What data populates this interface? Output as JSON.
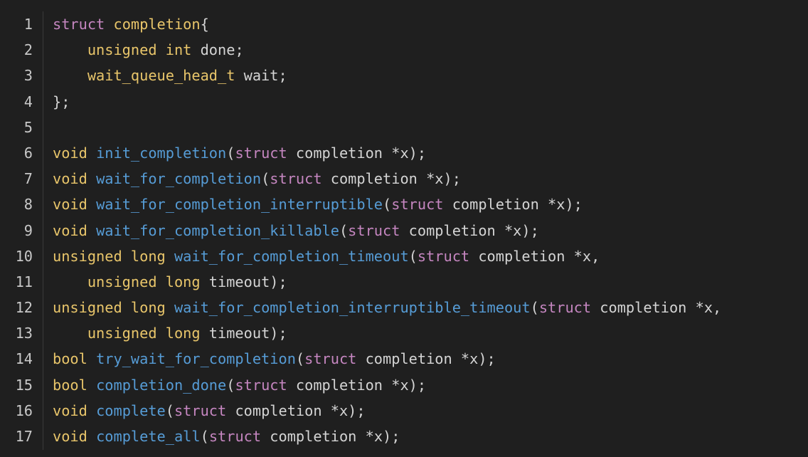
{
  "colors": {
    "background": "#1f1f1f",
    "keyword": "#e8c56a",
    "struct_keyword": "#c586c0",
    "function": "#569cd6",
    "plain": "#d4d4d4",
    "line_number": "#c8c8c8"
  },
  "lines": [
    {
      "num": "1",
      "tokens": [
        {
          "t": "struct",
          "k": "struct"
        },
        {
          "t": " ",
          "k": "space"
        },
        {
          "t": "completion",
          "k": "type"
        },
        {
          "t": "{",
          "k": "plain"
        }
      ]
    },
    {
      "num": "2",
      "tokens": [
        {
          "t": "    ",
          "k": "space"
        },
        {
          "t": "unsigned",
          "k": "keyword"
        },
        {
          "t": " ",
          "k": "space"
        },
        {
          "t": "int",
          "k": "keyword"
        },
        {
          "t": " done;",
          "k": "plain"
        }
      ]
    },
    {
      "num": "3",
      "tokens": [
        {
          "t": "    ",
          "k": "space"
        },
        {
          "t": "wait_queue_head_t",
          "k": "type"
        },
        {
          "t": " wait;",
          "k": "plain"
        }
      ]
    },
    {
      "num": "4",
      "tokens": [
        {
          "t": "};",
          "k": "plain"
        }
      ]
    },
    {
      "num": "5",
      "tokens": []
    },
    {
      "num": "6",
      "tokens": [
        {
          "t": "void",
          "k": "keyword"
        },
        {
          "t": " ",
          "k": "space"
        },
        {
          "t": "init_completion",
          "k": "func"
        },
        {
          "t": "(",
          "k": "plain"
        },
        {
          "t": "struct",
          "k": "struct"
        },
        {
          "t": " completion *x);",
          "k": "plain"
        }
      ]
    },
    {
      "num": "7",
      "tokens": [
        {
          "t": "void",
          "k": "keyword"
        },
        {
          "t": " ",
          "k": "space"
        },
        {
          "t": "wait_for_completion",
          "k": "func"
        },
        {
          "t": "(",
          "k": "plain"
        },
        {
          "t": "struct",
          "k": "struct"
        },
        {
          "t": " completion *x);",
          "k": "plain"
        }
      ]
    },
    {
      "num": "8",
      "tokens": [
        {
          "t": "void",
          "k": "keyword"
        },
        {
          "t": " ",
          "k": "space"
        },
        {
          "t": "wait_for_completion_interruptible",
          "k": "func"
        },
        {
          "t": "(",
          "k": "plain"
        },
        {
          "t": "struct",
          "k": "struct"
        },
        {
          "t": " completion *x);",
          "k": "plain"
        }
      ]
    },
    {
      "num": "9",
      "tokens": [
        {
          "t": "void",
          "k": "keyword"
        },
        {
          "t": " ",
          "k": "space"
        },
        {
          "t": "wait_for_completion_killable",
          "k": "func"
        },
        {
          "t": "(",
          "k": "plain"
        },
        {
          "t": "struct",
          "k": "struct"
        },
        {
          "t": " completion *x);",
          "k": "plain"
        }
      ]
    },
    {
      "num": "10",
      "tokens": [
        {
          "t": "unsigned",
          "k": "keyword"
        },
        {
          "t": " ",
          "k": "space"
        },
        {
          "t": "long",
          "k": "keyword"
        },
        {
          "t": " ",
          "k": "space"
        },
        {
          "t": "wait_for_completion_timeout",
          "k": "func"
        },
        {
          "t": "(",
          "k": "plain"
        },
        {
          "t": "struct",
          "k": "struct"
        },
        {
          "t": " completion *x,",
          "k": "plain"
        }
      ]
    },
    {
      "num": "11",
      "tokens": [
        {
          "t": "    ",
          "k": "space"
        },
        {
          "t": "unsigned",
          "k": "keyword"
        },
        {
          "t": " ",
          "k": "space"
        },
        {
          "t": "long",
          "k": "keyword"
        },
        {
          "t": " timeout);",
          "k": "plain"
        }
      ]
    },
    {
      "num": "12",
      "tokens": [
        {
          "t": "unsigned",
          "k": "keyword"
        },
        {
          "t": " ",
          "k": "space"
        },
        {
          "t": "long",
          "k": "keyword"
        },
        {
          "t": " ",
          "k": "space"
        },
        {
          "t": "wait_for_completion_interruptible_timeout",
          "k": "func"
        },
        {
          "t": "(",
          "k": "plain"
        },
        {
          "t": "struct",
          "k": "struct"
        },
        {
          "t": " completion *x,",
          "k": "plain"
        }
      ]
    },
    {
      "num": "13",
      "tokens": [
        {
          "t": "    ",
          "k": "space"
        },
        {
          "t": "unsigned",
          "k": "keyword"
        },
        {
          "t": " ",
          "k": "space"
        },
        {
          "t": "long",
          "k": "keyword"
        },
        {
          "t": " timeout);",
          "k": "plain"
        }
      ]
    },
    {
      "num": "14",
      "tokens": [
        {
          "t": "bool",
          "k": "keyword"
        },
        {
          "t": " ",
          "k": "space"
        },
        {
          "t": "try_wait_for_completion",
          "k": "func"
        },
        {
          "t": "(",
          "k": "plain"
        },
        {
          "t": "struct",
          "k": "struct"
        },
        {
          "t": " completion *x);",
          "k": "plain"
        }
      ]
    },
    {
      "num": "15",
      "tokens": [
        {
          "t": "bool",
          "k": "keyword"
        },
        {
          "t": " ",
          "k": "space"
        },
        {
          "t": "completion_done",
          "k": "func"
        },
        {
          "t": "(",
          "k": "plain"
        },
        {
          "t": "struct",
          "k": "struct"
        },
        {
          "t": " completion *x);",
          "k": "plain"
        }
      ]
    },
    {
      "num": "16",
      "tokens": [
        {
          "t": "void",
          "k": "keyword"
        },
        {
          "t": " ",
          "k": "space"
        },
        {
          "t": "complete",
          "k": "func"
        },
        {
          "t": "(",
          "k": "plain"
        },
        {
          "t": "struct",
          "k": "struct"
        },
        {
          "t": " completion *x);",
          "k": "plain"
        }
      ]
    },
    {
      "num": "17",
      "tokens": [
        {
          "t": "void",
          "k": "keyword"
        },
        {
          "t": " ",
          "k": "space"
        },
        {
          "t": "complete_all",
          "k": "func"
        },
        {
          "t": "(",
          "k": "plain"
        },
        {
          "t": "struct",
          "k": "struct"
        },
        {
          "t": " completion *x);",
          "k": "plain"
        }
      ]
    }
  ]
}
